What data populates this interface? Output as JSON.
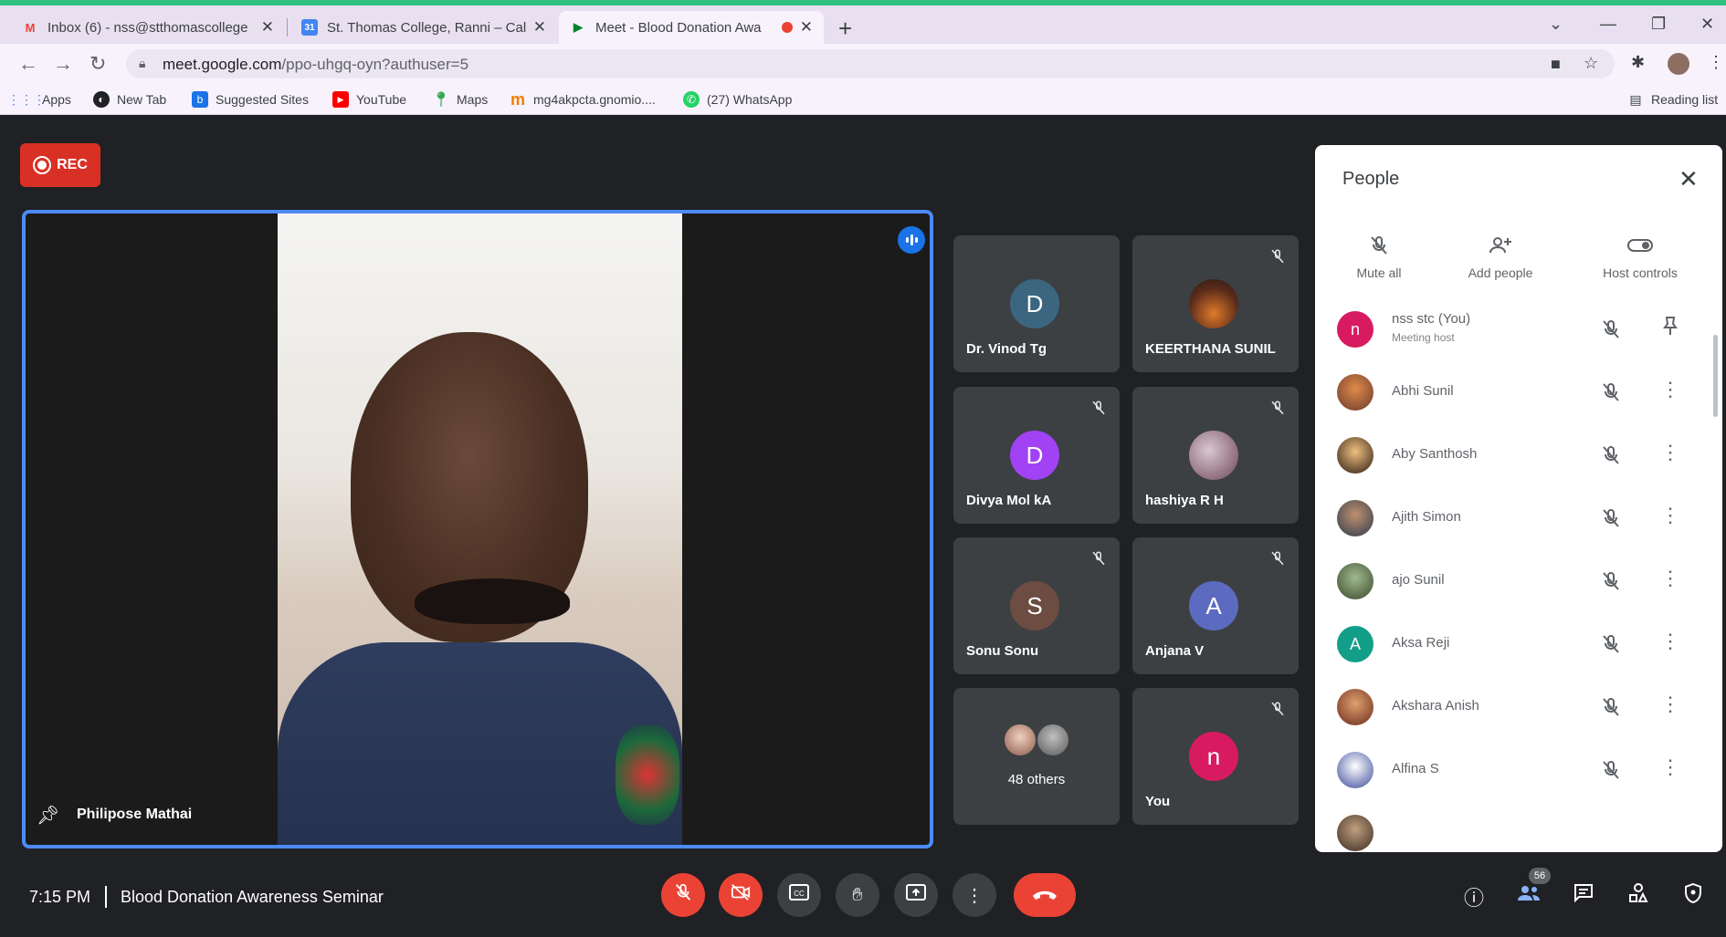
{
  "browser": {
    "tabs": [
      {
        "title": "Inbox (6) - nss@stthomascollege",
        "favicon": "M",
        "favicon_color": "#ea4335"
      },
      {
        "title": "St. Thomas College, Ranni – Cale",
        "favicon": "31",
        "favicon_color": "#4285f4"
      },
      {
        "title": "Meet - Blood Donation Awa",
        "favicon": "▶",
        "favicon_color": "#00832d",
        "active": true
      }
    ],
    "close_glyph": "✕",
    "new_tab_glyph": "+",
    "url_host": "meet.google.com",
    "url_path": "/ppo-uhgq-oyn?authuser=5",
    "bookmarks": [
      {
        "label": "Apps",
        "color": "#4285f4",
        "glyph": "⋮⋮"
      },
      {
        "label": "New Tab",
        "color": "#202124",
        "glyph": "◐"
      },
      {
        "label": "Suggested Sites",
        "color": "#1a73e8",
        "glyph": "b"
      },
      {
        "label": "YouTube",
        "color": "#ff0000",
        "glyph": "▶"
      },
      {
        "label": "Maps",
        "color": "#34a853",
        "glyph": "◆"
      },
      {
        "label": "mg4akpcta.gnomio....",
        "color": "#f57c00",
        "glyph": "m"
      },
      {
        "label": "(27) WhatsApp",
        "color": "#25d366",
        "glyph": "✆"
      }
    ],
    "reading_list": "Reading list"
  },
  "meet": {
    "rec_label": "REC",
    "main_speaker": "Philipose Mathai",
    "tiles": [
      {
        "name": "Dr. Vinod Tg",
        "initial": "D",
        "color": "#3c6680",
        "muted": false
      },
      {
        "name": "KEERTHANA SUNIL",
        "initial": "",
        "color": "#8a4a2a",
        "muted": true
      },
      {
        "name": "Divya Mol kA",
        "initial": "D",
        "color": "#a142f4",
        "muted": true
      },
      {
        "name": "hashiya R H",
        "initial": "",
        "color": "#b49aa8",
        "muted": true
      },
      {
        "name": "Sonu Sonu",
        "initial": "S",
        "color": "#6d4c41",
        "muted": true
      },
      {
        "name": "Anjana V",
        "initial": "A",
        "color": "#5c6bc0",
        "muted": true
      },
      {
        "name": "48 others",
        "initial": "",
        "color": "#5f6368",
        "muted": false
      },
      {
        "name": "You",
        "initial": "n",
        "color": "#d81b60",
        "muted": true
      }
    ],
    "people_panel": {
      "title": "People",
      "actions": [
        "Mute all",
        "Add people",
        "Host controls"
      ],
      "participants": [
        {
          "name": "nss stc (You)",
          "subtitle": "Meeting host",
          "initial": "n",
          "color": "#d81b60"
        },
        {
          "name": "Abhi Sunil",
          "initial": "",
          "color": "#c05a2a"
        },
        {
          "name": "Aby Santhosh",
          "initial": "",
          "color": "#3a2a20"
        },
        {
          "name": "Ajith Simon",
          "initial": "",
          "color": "#2d3a4a"
        },
        {
          "name": "ajo Sunil",
          "initial": "",
          "color": "#5a7a4a"
        },
        {
          "name": "Aksa Reji",
          "initial": "A",
          "color": "#129e88"
        },
        {
          "name": "Akshara Anish",
          "initial": "",
          "color": "#7a3a2a"
        },
        {
          "name": "Alfina S",
          "initial": "",
          "color": "#3a4a9a"
        }
      ]
    },
    "bottom": {
      "time": "7:15 PM",
      "meeting_title": "Blood Donation Awareness Seminar",
      "people_count": "56"
    }
  }
}
